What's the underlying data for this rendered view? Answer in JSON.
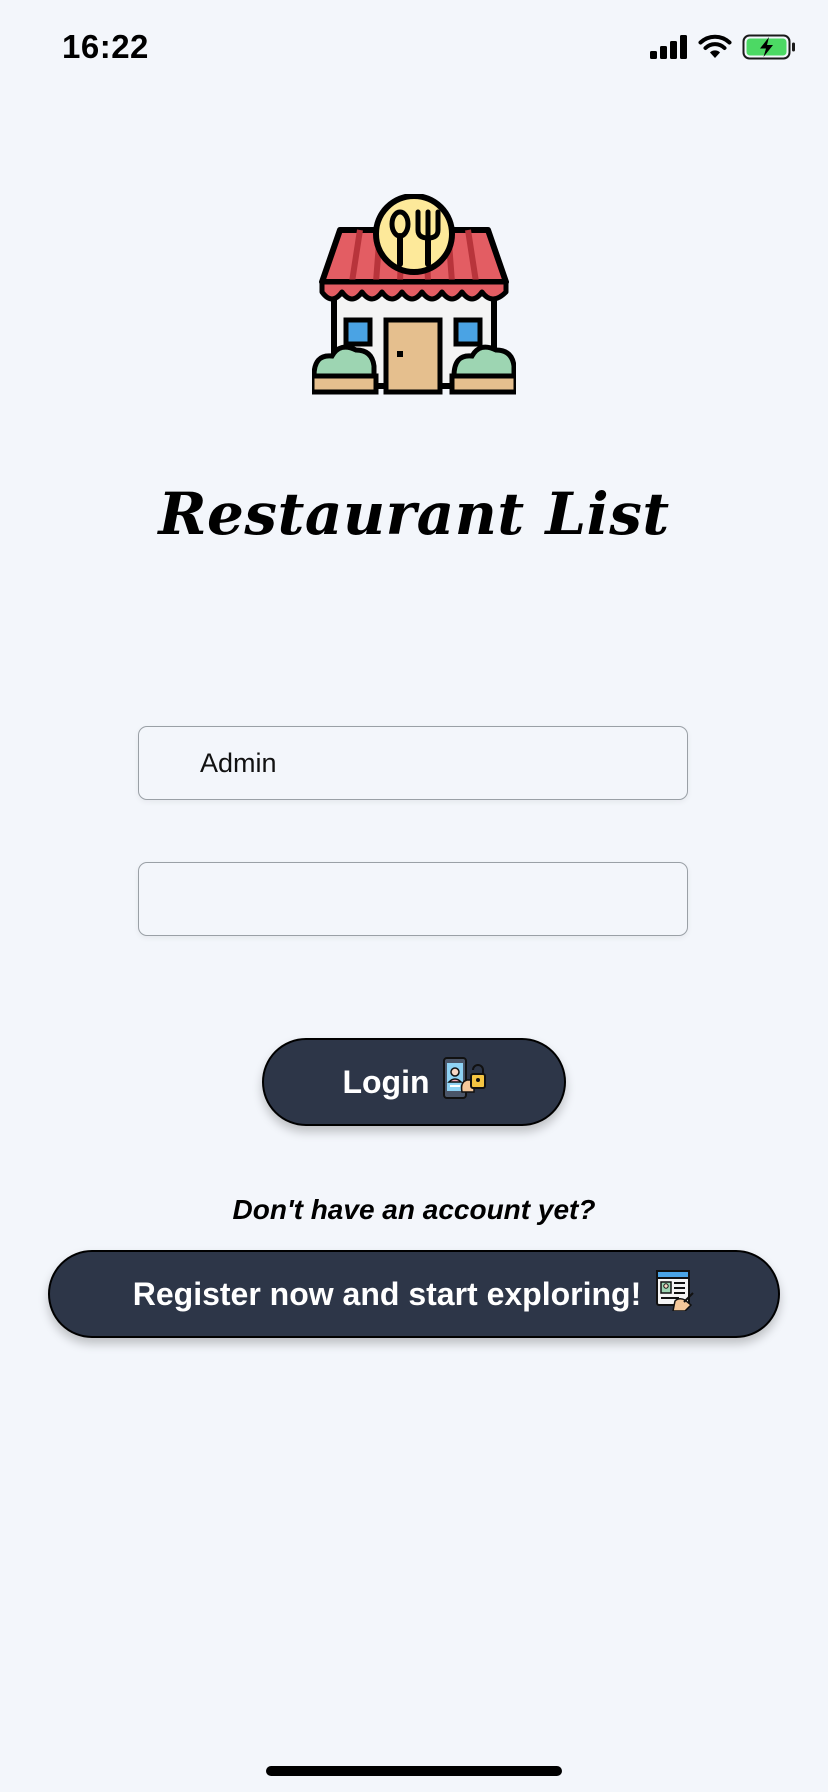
{
  "status_bar": {
    "time": "16:22",
    "icons": [
      "cellular-signal-icon",
      "wifi-icon",
      "battery-charging-icon"
    ]
  },
  "app": {
    "logo_icon": "restaurant-storefront-icon",
    "title": "Restaurant List"
  },
  "form": {
    "username_value": "Admin",
    "password_value": ""
  },
  "actions": {
    "login_label": "Login",
    "login_icon": "phone-lock-login-icon",
    "prompt": "Don't have an account yet?",
    "register_label": "Register now and start exploring!",
    "register_icon": "registration-form-icon"
  },
  "colors": {
    "background": "#f3f6fb",
    "button": "#2d3648",
    "awning_red": "#e35d63",
    "sign_yellow": "#fde99a",
    "door": "#e5bf8e",
    "window": "#4aa3e4",
    "bush": "#9dd5b2",
    "battery_green": "#4cd964"
  }
}
